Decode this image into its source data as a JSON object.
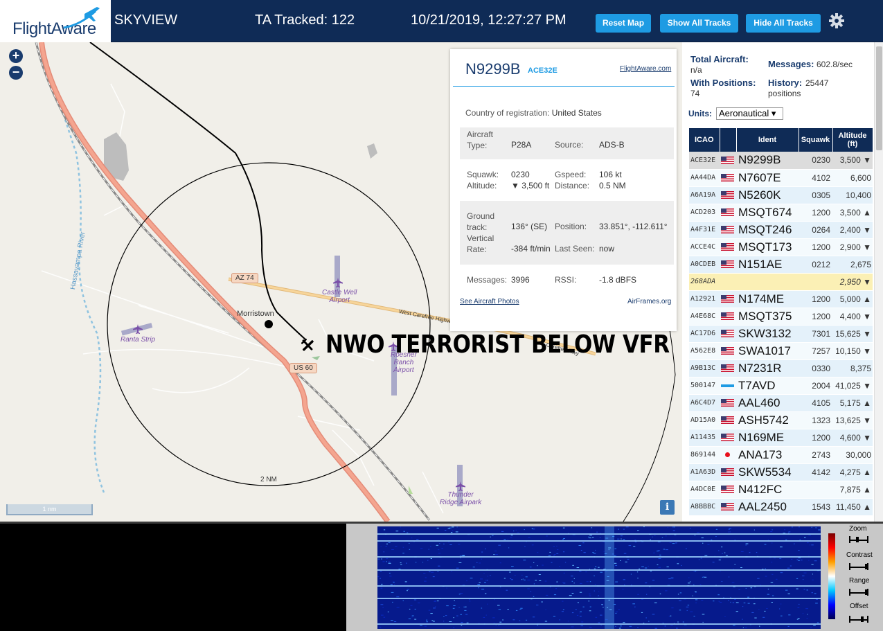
{
  "header": {
    "logo_text": "FlightAware",
    "app_name": "SKYVIEW",
    "tracked": "TA Tracked: 122",
    "datetime": "10/21/2019, 12:27:27 PM",
    "buttons": {
      "reset_map": "Reset Map",
      "show_all": "Show All Tracks",
      "hide_all": "Hide All Tracks"
    },
    "brand_color": "#0f2b56",
    "button_color": "#1e9be3"
  },
  "map": {
    "zoom_in": "+",
    "zoom_out": "−",
    "labels": {
      "river": "Hassayampa River",
      "town": "Morristown",
      "road_west_carefree": "West Carefree Highway",
      "road_carefree_hwy": "Carefree Hwy",
      "range_ring": "2 NM",
      "scale": "1 nm",
      "info": "i"
    },
    "shields": {
      "az74": "AZ 74",
      "us60": "US 60"
    },
    "airports": {
      "castle_well": [
        "Castle Well",
        "Airport"
      ],
      "ranta_strip": [
        "Ranta Strip"
      ],
      "roesner": [
        "Roesner",
        "Ranch",
        "Airport"
      ],
      "thunder_ridge": [
        "Thunder",
        "Ridge Airpark"
      ]
    },
    "overlay_text": "NWO TERRORIST BELOW VFR"
  },
  "selected": {
    "ident": "N9299B",
    "icao": "ACE32E",
    "fa_link": "FlightAware.com",
    "country_label": "Country of registration:",
    "country": "United States",
    "aircraft_type_label1": "Aircraft",
    "aircraft_type_label2": "Type:",
    "aircraft_type": "P28A",
    "source_label": "Source:",
    "source": "ADS-B",
    "squawk_label": "Squawk:",
    "squawk": "0230",
    "gspeed_label": "Gspeed:",
    "gspeed": "106 kt",
    "altitude_label": "Altitude:",
    "altitude": "▼ 3,500 ft",
    "distance_label": "Distance:",
    "distance": "0.5 NM",
    "ground_label1": "Ground",
    "ground_label2": "track:",
    "ground_track": "136° (SE)",
    "position_label": "Position:",
    "position": "33.851°, -112.611°",
    "vrate_label1": "Vertical",
    "vrate_label2": "Rate:",
    "vrate": "-384 ft/min",
    "lastseen_label": "Last Seen:",
    "lastseen": "now",
    "messages_label": "Messages:",
    "messages": "3996",
    "rssi_label": "RSSI:",
    "rssi": "-1.8 dBFS",
    "photos_link": "See Aircraft Photos",
    "airframes_link": "AirFrames.org"
  },
  "sidebar": {
    "total_label": "Total Aircraft:",
    "total": "n/a",
    "messages_label": "Messages:",
    "messages": "602.8/sec",
    "withpos_label": "With Positions:",
    "withpos": "74",
    "history_label": "History:",
    "history": "25447",
    "history_unit": "positions",
    "units_label": "Units:",
    "units_value": "Aeronautical ▾",
    "columns": {
      "icao": "ICAO",
      "ident": "Ident",
      "squawk": "Squawk",
      "alt1": "Altitude",
      "alt2": "(ft)"
    },
    "rows": [
      {
        "icao": "ACE32E",
        "flag": "us",
        "ident": "N9299B",
        "squawk": "0230",
        "alt": "3,500 ▼"
      },
      {
        "icao": "AA44DA",
        "flag": "us",
        "ident": "N7607E",
        "squawk": "4102",
        "alt": "6,600"
      },
      {
        "icao": "A6A19A",
        "flag": "us",
        "ident": "N5260K",
        "squawk": "0305",
        "alt": "10,400"
      },
      {
        "icao": "ACD203",
        "flag": "us",
        "ident": "MSQT674",
        "squawk": "1200",
        "alt": "3,500 ▲"
      },
      {
        "icao": "A4F31E",
        "flag": "us",
        "ident": "MSQT246",
        "squawk": "0264",
        "alt": "2,400 ▼"
      },
      {
        "icao": "ACCE4C",
        "flag": "us",
        "ident": "MSQT173",
        "squawk": "1200",
        "alt": "2,900 ▼"
      },
      {
        "icao": "A0CDEB",
        "flag": "us",
        "ident": "N151AE",
        "squawk": "0212",
        "alt": "2,675"
      },
      {
        "icao": "268ADA",
        "flag": "",
        "ident": "",
        "squawk": "",
        "alt": "2,950 ▼"
      },
      {
        "icao": "A12921",
        "flag": "us",
        "ident": "N174ME",
        "squawk": "1200",
        "alt": "5,000 ▲"
      },
      {
        "icao": "A4E68C",
        "flag": "us",
        "ident": "MSQT375",
        "squawk": "1200",
        "alt": "4,400 ▼"
      },
      {
        "icao": "AC17D6",
        "flag": "us",
        "ident": "SKW3132",
        "squawk": "7301",
        "alt": "15,625 ▼"
      },
      {
        "icao": "A562E8",
        "flag": "us",
        "ident": "SWA1017",
        "squawk": "7257",
        "alt": "10,150 ▼"
      },
      {
        "icao": "A9B13C",
        "flag": "us",
        "ident": "N7231R",
        "squawk": "0330",
        "alt": "8,375"
      },
      {
        "icao": "500147",
        "flag": "bar",
        "ident": "T7AVD",
        "squawk": "2004",
        "alt": "41,025 ▼"
      },
      {
        "icao": "A6C4D7",
        "flag": "us",
        "ident": "AAL460",
        "squawk": "4105",
        "alt": "5,175 ▲"
      },
      {
        "icao": "AD15A0",
        "flag": "us",
        "ident": "ASH5742",
        "squawk": "1323",
        "alt": "13,625 ▼"
      },
      {
        "icao": "A11435",
        "flag": "us",
        "ident": "N169ME",
        "squawk": "1200",
        "alt": "4,600 ▼"
      },
      {
        "icao": "869144",
        "flag": "jp",
        "ident": "ANA173",
        "squawk": "2743",
        "alt": "30,000"
      },
      {
        "icao": "A1A63D",
        "flag": "us",
        "ident": "SKW5534",
        "squawk": "4142",
        "alt": "4,275 ▲"
      },
      {
        "icao": "A4DC0E",
        "flag": "us",
        "ident": "N412FC",
        "squawk": "",
        "alt": "7,875 ▲"
      },
      {
        "icao": "A8BBBC",
        "flag": "us",
        "ident": "AAL2450",
        "squawk": "1543",
        "alt": "11,450 ▲"
      }
    ]
  },
  "waterfall": {
    "zoom": "Zoom",
    "contrast": "Contrast",
    "range": "Range",
    "offset": "Offset"
  }
}
